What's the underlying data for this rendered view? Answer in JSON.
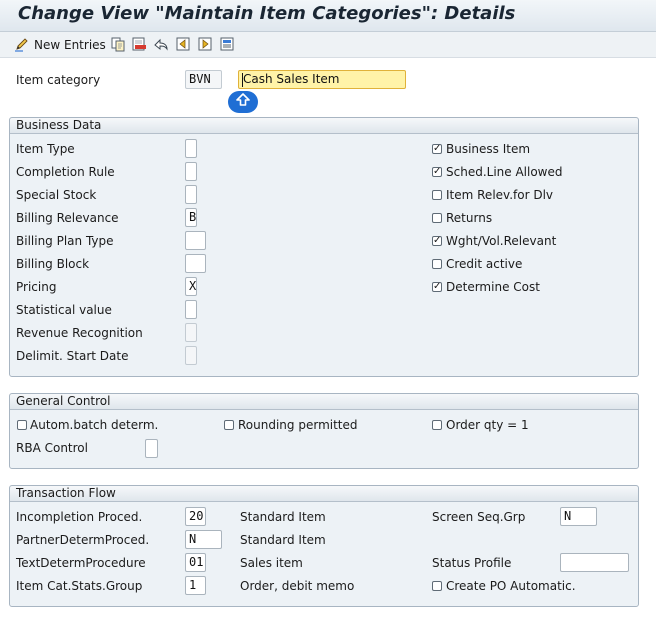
{
  "window": {
    "title": "Change View \"Maintain Item Categories\": Details"
  },
  "toolbar": {
    "new_entries_label": "New Entries",
    "icons": [
      "pencil-edit-icon",
      "copy-icon",
      "delete-icon",
      "undo-icon",
      "previous-entry-icon",
      "next-entry-icon",
      "display-variant-icon"
    ]
  },
  "header": {
    "item_category_label": "Item category",
    "item_category_value": "BVN",
    "item_category_desc": "Cash Sales Item"
  },
  "business_data": {
    "title": "Business Data",
    "fields": [
      {
        "label": "Item Type",
        "value": ""
      },
      {
        "label": "Completion Rule",
        "value": ""
      },
      {
        "label": "Special Stock",
        "value": ""
      },
      {
        "label": "Billing Relevance",
        "value": "B"
      },
      {
        "label": "Billing Plan Type",
        "value": ""
      },
      {
        "label": "Billing Block",
        "value": ""
      },
      {
        "label": "Pricing",
        "value": "X"
      },
      {
        "label": "Statistical value",
        "value": ""
      },
      {
        "label": "Revenue Recognition",
        "value": ""
      },
      {
        "label": "Delimit. Start Date",
        "value": ""
      }
    ],
    "checkboxes": [
      {
        "label": "Business Item",
        "checked": true,
        "mark": "✓"
      },
      {
        "label": "Sched.Line Allowed",
        "checked": true,
        "mark": "✓"
      },
      {
        "label": "Item Relev.for Dlv",
        "checked": false,
        "mark": ""
      },
      {
        "label": "Returns",
        "checked": false,
        "mark": ""
      },
      {
        "label": "Wght/Vol.Relevant",
        "checked": true,
        "mark": "✓"
      },
      {
        "label": "Credit active",
        "checked": false,
        "mark": ""
      },
      {
        "label": "Determine Cost",
        "checked": true,
        "mark": "✓"
      }
    ]
  },
  "general_control": {
    "title": "General Control",
    "autom_batch_label": "Autom.batch determ.",
    "autom_batch_checked": false,
    "rounding_label": "Rounding permitted",
    "rounding_checked": false,
    "order_qty_label": "Order qty = 1",
    "order_qty_checked": false,
    "rba_label": "RBA Control",
    "rba_value": ""
  },
  "transaction_flow": {
    "title": "Transaction Flow",
    "rows": [
      {
        "label": "Incompletion Proced.",
        "value": "20",
        "desc": "Standard Item"
      },
      {
        "label": "PartnerDetermProced.",
        "value": "N",
        "desc": "Standard Item"
      },
      {
        "label": "TextDetermProcedure",
        "value": "01",
        "desc": "Sales item"
      },
      {
        "label": "Item Cat.Stats.Group",
        "value": "1",
        "desc": "Order, debit memo"
      }
    ],
    "screen_seq_label": "Screen Seq.Grp",
    "screen_seq_value": "N",
    "status_profile_label": "Status Profile",
    "status_profile_value": "",
    "create_po_label": "Create PO Automatic.",
    "create_po_checked": false
  },
  "colors": {
    "accent": "#1f6ed4",
    "highlight_field": "#fff3a8",
    "group_background": "#edf2f6"
  }
}
